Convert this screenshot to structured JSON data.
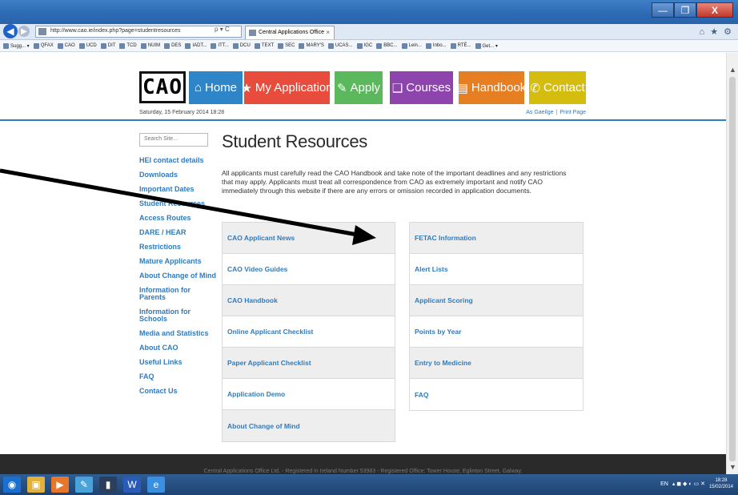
{
  "browser": {
    "url": "http://www.cao.ie/index.php?page=studentresources",
    "tab_title": "Central Applications Office",
    "tab_close": "×",
    "addr_tools": "ρ ▾ C",
    "window_controls": [
      "—",
      "❐",
      "X"
    ],
    "right_icons": "⌂ ★ ⚙",
    "favorites": [
      "Sugg... ▾",
      "QFAX",
      "CAO",
      "UCD",
      "DIT",
      "TCD",
      "NUIM",
      "DES",
      "IADT...",
      "ITT...",
      "DCU",
      "TEXT",
      "SEC",
      "MARY'S",
      "UCAS...",
      "IGC",
      "BBC...",
      "Lein...",
      "Inbo...",
      "RTÉ...",
      "Get... ▾"
    ]
  },
  "header": {
    "logo": "CAO",
    "nav": [
      {
        "label": "Home",
        "icon": "house-icon",
        "glyph": "⌂",
        "color": "#2e86c9"
      },
      {
        "label": "My Application",
        "icon": "star-icon",
        "glyph": "★",
        "color": "#e74c3c"
      },
      {
        "label": "Apply",
        "icon": "edit-icon",
        "glyph": "✎",
        "color": "#5cb85c"
      },
      {
        "label": "Courses",
        "icon": "book-icon",
        "glyph": "❑",
        "color": "#8e44ad"
      },
      {
        "label": "Handbook",
        "icon": "handbook-icon",
        "glyph": "▤",
        "color": "#e67e22"
      },
      {
        "label": "Contact",
        "icon": "phone-icon",
        "glyph": "✆",
        "color": "#d4bd0e"
      }
    ],
    "date": "Saturday, 15 February 2014 18:28",
    "link_gaeilge": "As Gaeilge",
    "link_sep": "|",
    "link_print": "Print Page"
  },
  "search": {
    "placeholder": "Search Site..."
  },
  "sidebar": {
    "items": [
      "HEI contact details",
      "Downloads",
      "Important Dates",
      "Student Resources",
      "Access Routes",
      "DARE / HEAR",
      "Restrictions",
      "Mature Applicants",
      "About Change of Mind",
      "Information for Parents",
      "Information for Schools",
      "Media and Statistics",
      "About CAO",
      "Useful Links",
      "FAQ",
      "Contact Us"
    ]
  },
  "main": {
    "title": "Student Resources",
    "intro": "All applicants must carefully read the CAO Handbook and take note of the important deadlines and any restrictions that may apply. Applicants must treat all correspondence from CAO as extremely important and notify CAO immediately through this website if there are any errors or omission recorded in application documents.",
    "left_links": [
      "CAO Applicant News",
      "CAO Video Guides",
      "CAO Handbook",
      "Online Applicant Checklist",
      "Paper Applicant Checklist",
      "Application Demo",
      "About Change of Mind"
    ],
    "right_links": [
      "FETAC Information",
      "Alert Lists",
      "Applicant Scoring",
      "Points by Year",
      "Entry to Medicine",
      "FAQ"
    ]
  },
  "footer": {
    "text": "Central Applications Office Ltd. - Registered in Ireland Number 53983 - Registered Office: Tower House, Eglinton Street, Galway."
  },
  "taskbar": {
    "apps": [
      {
        "icon": "start-orb-icon",
        "glyph": "◉"
      },
      {
        "icon": "folder-icon",
        "glyph": "▣"
      },
      {
        "icon": "media-player-icon",
        "glyph": "▶"
      },
      {
        "icon": "paint-icon",
        "glyph": "✎"
      },
      {
        "icon": "notebook-icon",
        "glyph": "▮"
      },
      {
        "icon": "word-icon",
        "glyph": "W"
      },
      {
        "icon": "ie-icon",
        "glyph": "e"
      }
    ],
    "lang": "EN",
    "time": "18:28",
    "date": "15/02/2014"
  }
}
